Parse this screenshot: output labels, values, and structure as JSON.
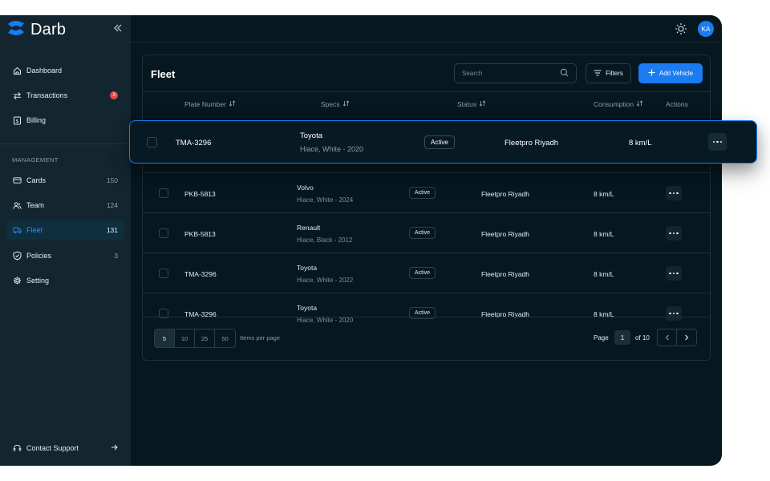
{
  "brand": {
    "name": "Darb"
  },
  "colors": {
    "accent": "#1a7cf0",
    "background": "#061720",
    "sidebar": "#13262f",
    "danger": "#e5484d"
  },
  "sidebar": {
    "items": [
      {
        "label": "Dashboard",
        "icon": "home-icon"
      },
      {
        "label": "Transactions",
        "icon": "transfer-icon",
        "badge": "3"
      },
      {
        "label": "Billing",
        "icon": "billing-icon"
      }
    ],
    "section_label": "MANAGEMENT",
    "management": [
      {
        "label": "Cards",
        "count": "150",
        "icon": "card-icon"
      },
      {
        "label": "Team",
        "count": "124",
        "icon": "team-icon"
      },
      {
        "label": "Fleet",
        "count": "131",
        "icon": "truck-icon",
        "active": true
      },
      {
        "label": "Policies",
        "count": "3",
        "icon": "shield-icon"
      },
      {
        "label": "Setting",
        "icon": "gear-icon"
      }
    ],
    "support": "Contact Support"
  },
  "topbar": {
    "avatar": "KA"
  },
  "fleet": {
    "title": "Fleet",
    "search_placeholder": "Search",
    "filters_label": "Filters",
    "add_label": "Add Vehicle",
    "columns": {
      "plate": "Plate Number",
      "specs": "Specs",
      "status": "Status",
      "consumption": "Consumption",
      "actions": "Actions"
    },
    "rows": [
      {
        "plate": "TMA-3296",
        "make": "Toyota",
        "specs": "Hiace, White - 2020",
        "status": "Active",
        "location": "Fleetpro Riyadh",
        "consumption": "8 km/L"
      },
      {
        "plate": "PKB-5813",
        "make": "Volvo",
        "specs": "Hiace, White - 2024",
        "status": "Active",
        "location": "Fleetpro Riyadh",
        "consumption": "8 km/L"
      },
      {
        "plate": "PKB-5813",
        "make": "Renault",
        "specs": "Hiace, Black - 2012",
        "status": "Active",
        "location": "Fleetpro Riyadh",
        "consumption": "8 km/L"
      },
      {
        "plate": "TMA-3296",
        "make": "Toyota",
        "specs": "Hiace, White - 2022",
        "status": "Active",
        "location": "Fleetpro Riyadh",
        "consumption": "8 km/L"
      },
      {
        "plate": "TMA-3296",
        "make": "Toyota",
        "specs": "Hiace, White - 2020",
        "status": "Active",
        "location": "Fleetpro Riyadh",
        "consumption": "8 km/L"
      }
    ],
    "pagination": {
      "sizes": [
        "5",
        "10",
        "25",
        "50"
      ],
      "selected_size": "5",
      "items_per_page": "Items per page",
      "page_label": "Page",
      "current_page": "1",
      "of_label": "of 10"
    }
  }
}
